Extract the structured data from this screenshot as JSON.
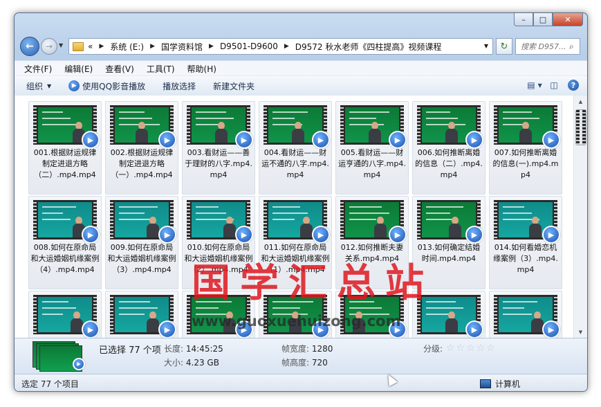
{
  "window": {
    "minimize_icon": "minimize-icon",
    "maximize_icon": "maximize-icon",
    "close_icon": "close-icon"
  },
  "nav": {
    "back_icon": "back-arrow-icon",
    "forward_icon": "forward-arrow-icon",
    "chevron": "«",
    "breadcrumbs": [
      "系统 (E:)",
      "国学资料馆",
      "D9501-D9600",
      "D9572 秋水老师《四柱提高》视频课程"
    ],
    "search_placeholder": "搜索 D957..."
  },
  "menu": [
    "文件(F)",
    "编辑(E)",
    "查看(V)",
    "工具(T)",
    "帮助(H)"
  ],
  "commands": {
    "organize": "组织",
    "play_qq": "使用QQ影音播放",
    "play_select": "播放选择",
    "new_folder": "新建文件夹"
  },
  "files": [
    {
      "name": "001.根据财运规律制定进退方略（二）.mp4.mp4",
      "screen": "green",
      "person": 0.75
    },
    {
      "name": "002.根据财运规律制定进退方略（一）.mp4.mp4",
      "screen": "green",
      "person": 0.5
    },
    {
      "name": "003.看财运——善于理财的八字.mp4.mp4",
      "screen": "green",
      "person": 0.55
    },
    {
      "name": "004.看财运——财运不通的八字.mp4.mp4",
      "screen": "green",
      "person": 0.55
    },
    {
      "name": "005.看财运——财运亨通的八字.mp4.mp4",
      "screen": "green",
      "person": 0.55
    },
    {
      "name": "006.如何推断离婚的信息（二）.mp4.mp4",
      "screen": "green",
      "person": 0.55
    },
    {
      "name": "007.如何推断离婚的信息(一).mp4.mp4",
      "screen": "green",
      "person": 0.5
    },
    {
      "name": "008.如何在原命局和大运婚姻机缘案例（4）.mp4.mp4",
      "screen": "teal",
      "person": 0.75
    },
    {
      "name": "009.如何在原命局和大运婚姻机缘案例（3）.mp4.mp4",
      "screen": "teal",
      "person": 0.7
    },
    {
      "name": "010.如何在原命局和大运婚姻机缘案例（2）.mp4.mp4",
      "screen": "teal",
      "person": 0.7
    },
    {
      "name": "011.如何在原命局和大运婚姻机缘案例（1）.mp4.mp4",
      "screen": "teal",
      "person": 0.7
    },
    {
      "name": "012.如何推断夫妻关系.mp4.mp4",
      "screen": "green",
      "person": 0.65
    },
    {
      "name": "013.如何确定结婚时间.mp4.mp4",
      "screen": "green",
      "person": 0.62
    },
    {
      "name": "014.如何看婚恋机缘案例（3）.mp4.mp4",
      "screen": "teal",
      "person": 0.68
    },
    {
      "name": "",
      "screen": "teal",
      "person": 0.72
    },
    {
      "name": "",
      "screen": "teal",
      "person": 0.7
    },
    {
      "name": "",
      "screen": "green",
      "person": 0.7
    },
    {
      "name": "",
      "screen": "green",
      "person": 0.5
    },
    {
      "name": "",
      "screen": "green",
      "person": 0.25
    },
    {
      "name": "",
      "screen": "teal",
      "person": 0.55
    },
    {
      "name": "",
      "screen": "teal",
      "person": 0.72
    }
  ],
  "watermark": {
    "text": "国学汇总站",
    "url": "www.guoxuehuizong.com"
  },
  "details": {
    "selected": "已选择 77 个项",
    "length_label": "长度:",
    "length_value": "14:45:25",
    "size_label": "大小:",
    "size_value": "4.23 GB",
    "frame_width_label": "帧宽度:",
    "frame_width_value": "1280",
    "frame_height_label": "帧高度:",
    "frame_height_value": "720",
    "rating_label": "分级:",
    "rating_value": 0
  },
  "status": {
    "left": "选定 77 个项目",
    "right": "计算机"
  },
  "colors": {
    "screen_green": "#0c7a36",
    "screen_teal": "#0f8c8a",
    "watermark": "#e0181f"
  }
}
